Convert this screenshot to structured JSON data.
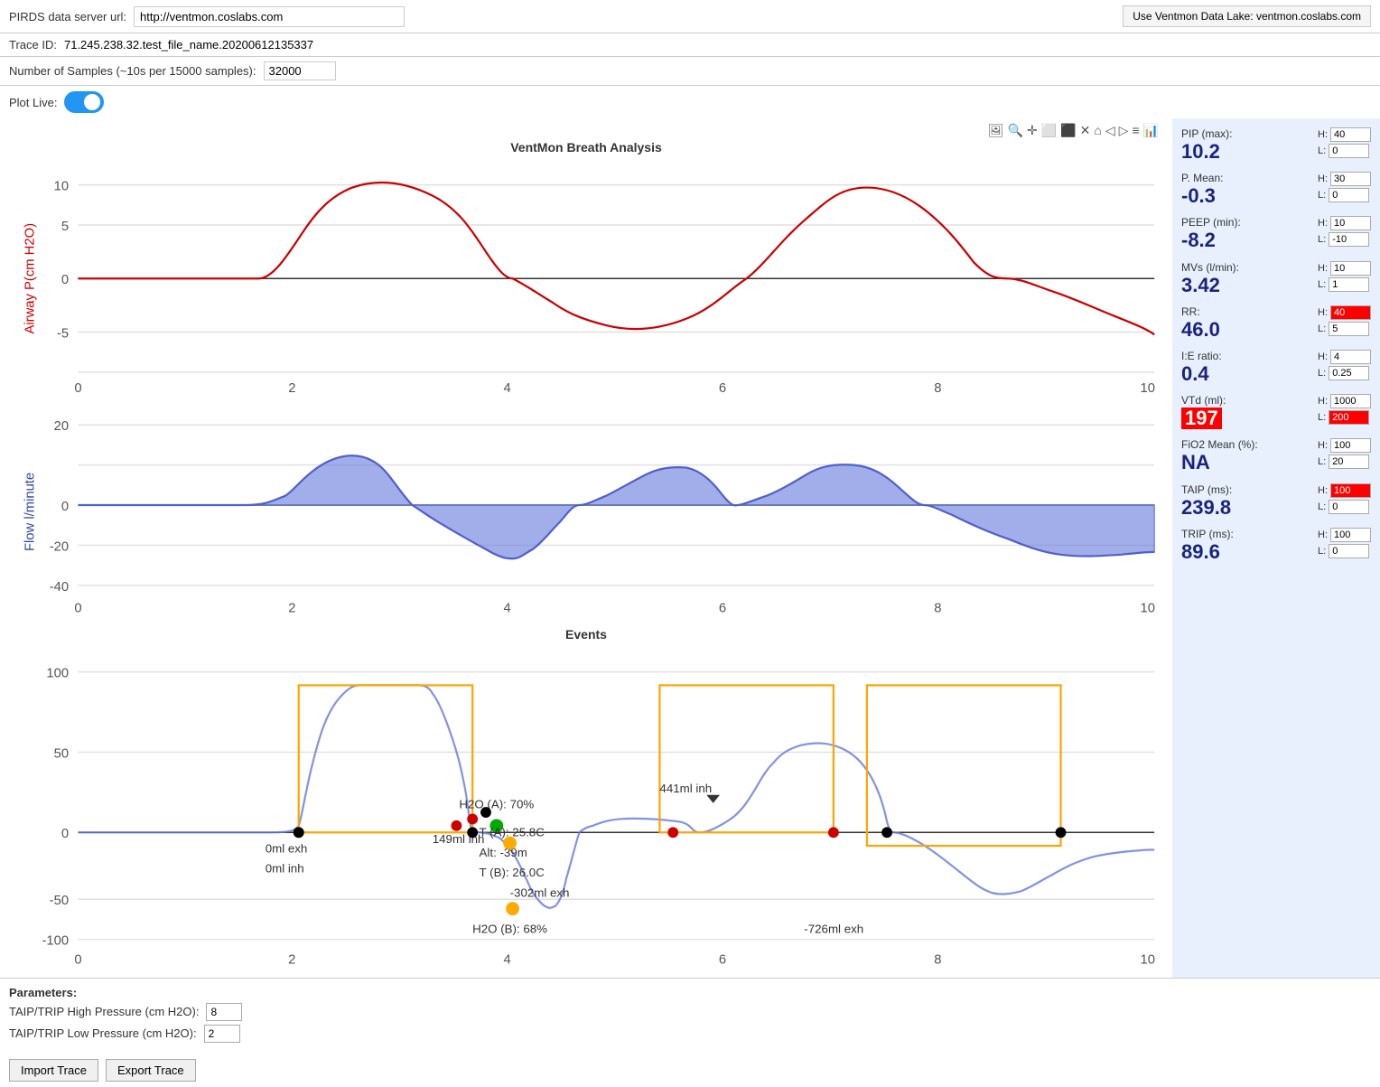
{
  "header": {
    "server_label": "PIRDS data server url:",
    "server_url": "http://ventmon.coslabs.com",
    "data_lake_btn": "Use Ventmon Data Lake: ventmon.coslabs.com"
  },
  "trace": {
    "label": "Trace ID:",
    "value": "71.245.238.32.test_file_name.20200612135337"
  },
  "samples": {
    "label": "Number of Samples (~10s per 15000 samples):",
    "value": "32000"
  },
  "plot_live": {
    "label": "Plot Live:"
  },
  "chart": {
    "title": "VentMon Breath Analysis",
    "events_title": "Events"
  },
  "metrics": [
    {
      "label": "PIP (max):",
      "value": "10.2",
      "h_val": "40",
      "l_val": "0",
      "h_alert": false,
      "l_alert": false
    },
    {
      "label": "P. Mean:",
      "value": "-0.3",
      "h_val": "30",
      "l_val": "0",
      "h_alert": false,
      "l_alert": false
    },
    {
      "label": "PEEP (min):",
      "value": "-8.2",
      "h_val": "10",
      "l_val": "-10",
      "h_alert": false,
      "l_alert": false
    },
    {
      "label": "MVs (l/min):",
      "value": "3.42",
      "h_val": "10",
      "l_val": "1",
      "h_alert": false,
      "l_alert": false
    },
    {
      "label": "RR:",
      "value": "46.0",
      "h_val": "40",
      "l_val": "5",
      "h_alert": true,
      "l_alert": false
    },
    {
      "label": "I:E ratio:",
      "value": "0.4",
      "h_val": "4",
      "l_val": "0.25",
      "h_alert": false,
      "l_alert": false
    },
    {
      "label": "VTd (ml):",
      "value": "197",
      "h_val": "1000",
      "l_val": "200",
      "h_alert": false,
      "l_alert": true,
      "value_alert": true
    },
    {
      "label": "FiO2 Mean (%):",
      "value": "NA",
      "h_val": "100",
      "l_val": "20",
      "h_alert": false,
      "l_alert": false
    },
    {
      "label": "TAIP (ms):",
      "value": "239.8",
      "h_val": "100",
      "l_val": "0",
      "h_alert": true,
      "l_alert": false
    },
    {
      "label": "TRIP (ms):",
      "value": "89.6",
      "h_val": "100",
      "l_val": "0",
      "h_alert": false,
      "l_alert": false
    }
  ],
  "params": {
    "title": "Parameters:",
    "high_label": "TAIP/TRIP High Pressure (cm H2O):",
    "high_val": "8",
    "low_label": "TAIP/TRIP Low Pressure (cm H2O):",
    "low_val": "2"
  },
  "buttons": {
    "import": "Import Trace",
    "export": "Export Trace"
  },
  "toolbar_icons": [
    "📷",
    "🔍",
    "+",
    "⊞",
    "⊟",
    "✕",
    "⌂",
    "←",
    "→",
    "≡",
    "📊"
  ]
}
